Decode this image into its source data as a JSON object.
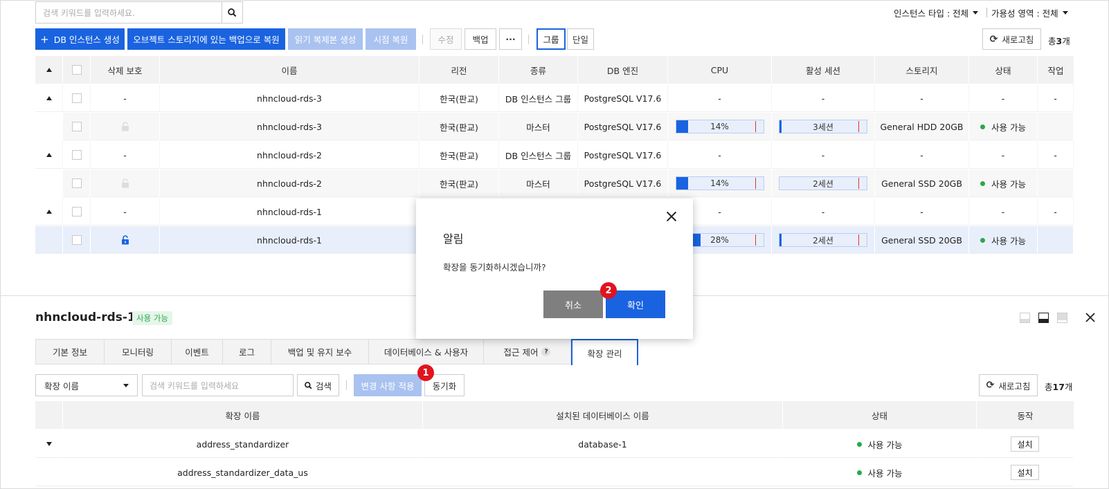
{
  "top": {
    "search_placeholder": "검색 키워드를 입력하세요.",
    "filter_instance_type": "인스턴스 타입 : 전체",
    "filter_availability": "가용성 영역 : 전체"
  },
  "toolbar": {
    "create_db": "DB 인스턴스 생성",
    "restore_object": "오브젝트 스토리지에 있는 백업으로 복원",
    "read_replica": "읽기 복제본 생성",
    "pitr": "시점 복원",
    "edit": "수정",
    "backup": "백업",
    "more": "···",
    "group": "그룹",
    "single": "단일",
    "refresh": "새로고침",
    "total_prefix": "총",
    "total_count": "3",
    "total_suffix": "개"
  },
  "table": {
    "headers": [
      "삭제 보호",
      "이름",
      "리전",
      "종류",
      "DB 엔진",
      "CPU",
      "활성 세션",
      "스토리지",
      "상태",
      "작업"
    ],
    "rows": [
      {
        "name": "nhncloud-rds-3",
        "protect": "-",
        "region": "한국(판교)",
        "kind": "DB 인스턴스 그룹",
        "engine": "PostgreSQL V17.6",
        "cpu": "-",
        "session": "-",
        "storage": "-",
        "status": "-",
        "action": "-"
      },
      {
        "name": "nhncloud-rds-3",
        "region": "한국(판교)",
        "kind": "마스터",
        "engine": "PostgreSQL V17.6",
        "cpu_label": "14%",
        "cpu_value": 0.14,
        "session_label": "3세션",
        "storage": "General HDD 20GB",
        "status": "사용 가능"
      },
      {
        "name": "nhncloud-rds-2",
        "protect": "-",
        "region": "한국(판교)",
        "kind": "DB 인스턴스 그룹",
        "engine": "PostgreSQL V17.6",
        "cpu": "-",
        "session": "-",
        "storage": "-",
        "status": "-",
        "action": "-"
      },
      {
        "name": "nhncloud-rds-2",
        "region": "한국(판교)",
        "kind": "마스터",
        "engine": "PostgreSQL V17.6",
        "cpu_label": "14%",
        "cpu_value": 0.14,
        "session_label": "2세션",
        "storage": "General SSD 20GB",
        "status": "사용 가능"
      },
      {
        "name": "nhncloud-rds-1",
        "protect": "-",
        "cpu": "-",
        "session": "-",
        "storage": "-",
        "status": "-",
        "action": "-"
      },
      {
        "name": "nhncloud-rds-1",
        "cpu_label": "28%",
        "cpu_value": 0.28,
        "session_label": "2세션",
        "storage": "General SSD 20GB",
        "status": "사용 가능"
      }
    ]
  },
  "detail": {
    "title": "nhncloud-rds-1",
    "badge": "사용 가능",
    "tabs": [
      "기본 정보",
      "모니터링",
      "이벤트",
      "로그",
      "백업 및 유지 보수",
      "데이터베이스 & 사용자",
      "접근 제어",
      "확장 관리"
    ],
    "tab_help": "?",
    "select_value": "확장 이름",
    "search_placeholder": "검색 키워드를 입력하세요",
    "search_btn": "검색",
    "apply_btn": "변경 사항 적용",
    "sync_btn": "동기화",
    "refresh": "새로고침",
    "total_prefix": "총",
    "total_count": "17",
    "total_suffix": "개",
    "headers": [
      "확장 이름",
      "설치된 데이터베이스 이름",
      "상태",
      "동작"
    ],
    "rows": [
      {
        "name": "address_standardizer",
        "db": "database-1",
        "status": "사용 가능",
        "action": "설치"
      },
      {
        "name": "address_standardizer_data_us",
        "db": "",
        "status": "사용 가능",
        "action": "설치"
      }
    ]
  },
  "modal": {
    "title": "알림",
    "message": "확장을 동기화하시겠습니까?",
    "cancel": "취소",
    "confirm": "확인"
  },
  "markers": {
    "one": "1",
    "two": "2"
  },
  "colors": {
    "primary": "#1a63e0",
    "danger": "#e0141e",
    "success": "#2aa84a"
  }
}
